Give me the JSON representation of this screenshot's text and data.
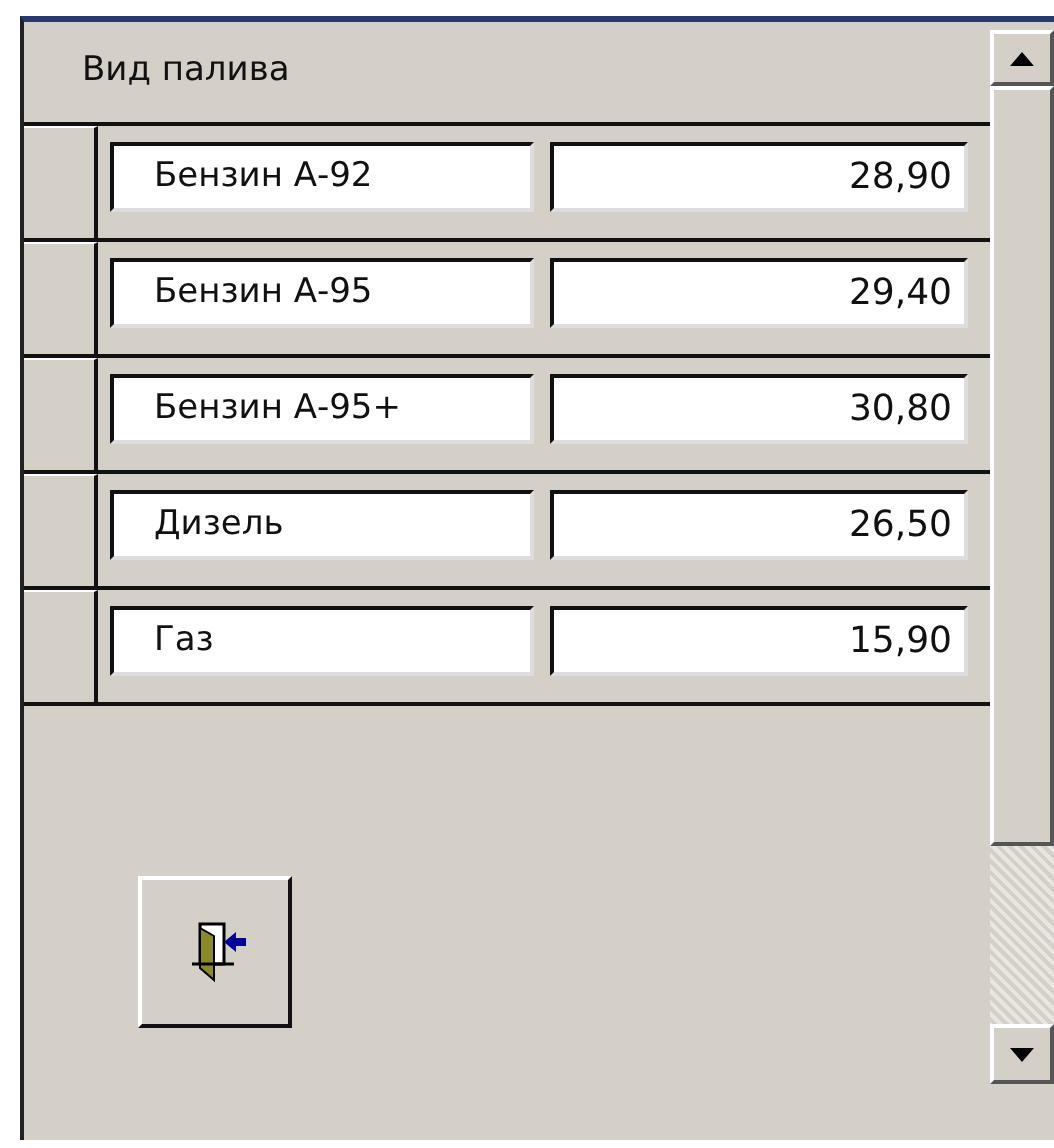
{
  "header": {
    "label": "Вид палива"
  },
  "rows": [
    {
      "fuel": "Бензин А-92",
      "price": "28,90"
    },
    {
      "fuel": "Бензин А-95",
      "price": "29,40"
    },
    {
      "fuel": "Бензин А-95+",
      "price": "30,80"
    },
    {
      "fuel": "Дизель",
      "price": "26,50"
    },
    {
      "fuel": "Газ",
      "price": "15,90"
    }
  ]
}
